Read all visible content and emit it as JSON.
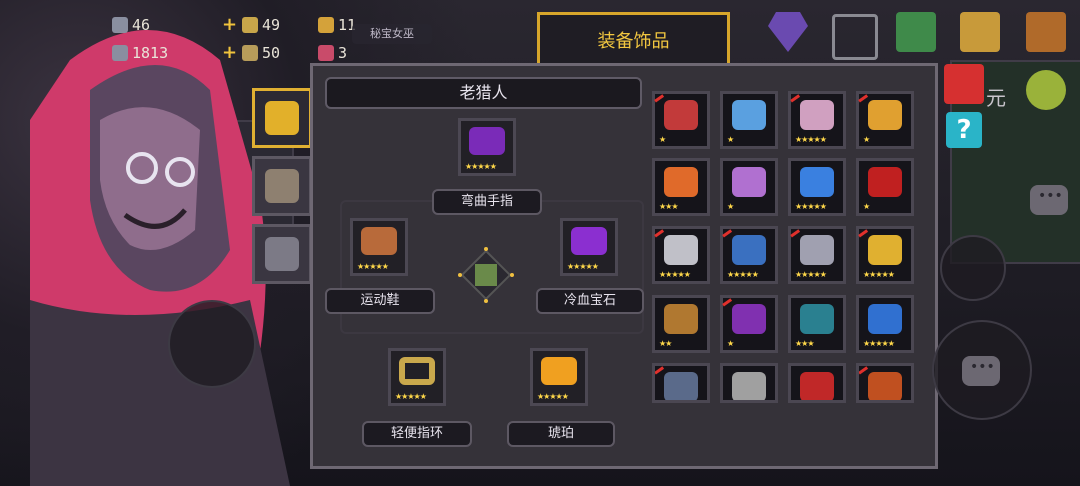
{
  "resources": [
    {
      "name": "gems",
      "value": "46",
      "color": "#8a8fa0"
    },
    {
      "name": "coins",
      "value": "49",
      "color": "#c8a64a"
    },
    {
      "name": "fish",
      "value": "11",
      "color": "#d4a23a"
    },
    {
      "name": "materials",
      "value": "1813",
      "color": "#8a8fa0"
    },
    {
      "name": "parts",
      "value": "50",
      "color": "#b79c5a"
    },
    {
      "name": "tickets",
      "value": "3",
      "color": "#c94b6a"
    }
  ],
  "witch_label": "秘宝女巫",
  "panel_title": "装备饰品",
  "character_name": "老猎人",
  "equipped": [
    {
      "label": "弯曲手指",
      "icon": "purple-ring-icon",
      "color": "#7a2bb8",
      "stars": "★★★★★"
    },
    {
      "label": "运动鞋",
      "icon": "sneaker-icon",
      "color": "#b86a3a",
      "stars": "★★★★★"
    },
    {
      "label": "冷血宝石",
      "icon": "purple-gem-icon",
      "color": "#8b2fd0",
      "stars": "★★★★★"
    },
    {
      "label": "轻便指环",
      "icon": "gold-ring-icon",
      "color": "#c9a84c",
      "stars": "★★★★★"
    },
    {
      "label": "琥珀",
      "icon": "amber-icon",
      "color": "#f0a020",
      "stars": "★★★★★"
    }
  ],
  "center_item": {
    "icon": "green-charm-icon",
    "color": "#6a8a4a"
  },
  "inventory": [
    {
      "icon": "red-bracelet-icon",
      "color": "#c23a3a",
      "stars": "★",
      "tag": true
    },
    {
      "icon": "blue-egg-icon",
      "color": "#5aa0e0",
      "stars": "★",
      "tag": false
    },
    {
      "icon": "necklace-icon",
      "color": "#d0a0c0",
      "stars": "★★★★★",
      "tag": true
    },
    {
      "icon": "gold-coin-icon",
      "color": "#e0a030",
      "stars": "★",
      "tag": true
    },
    {
      "icon": "target-icon",
      "color": "#e06a2a",
      "stars": "★★★",
      "tag": false
    },
    {
      "icon": "crystal-icon",
      "color": "#b070d0",
      "stars": "★",
      "tag": false
    },
    {
      "icon": "blue-gem-icon",
      "color": "#3a80e0",
      "stars": "★★★★★",
      "tag": false
    },
    {
      "icon": "red-crystal-icon",
      "color": "#c02020",
      "stars": "★",
      "tag": false
    },
    {
      "icon": "silver-feather-icon",
      "color": "#c0c0c8",
      "stars": "★★★★★",
      "tag": true
    },
    {
      "icon": "blue-boots-icon",
      "color": "#3a70c0",
      "stars": "★★★★★",
      "tag": true
    },
    {
      "icon": "chain-icon",
      "color": "#a0a0b0",
      "stars": "★★★★★",
      "tag": true
    },
    {
      "icon": "gold-helmet-icon",
      "color": "#e0b030",
      "stars": "★★★★★",
      "tag": true
    },
    {
      "icon": "cloak-icon",
      "color": "#b07830",
      "stars": "★★",
      "tag": false
    },
    {
      "icon": "purple-flame-icon",
      "color": "#8030b0",
      "stars": "★",
      "tag": true
    },
    {
      "icon": "teal-shell-icon",
      "color": "#2a8090",
      "stars": "★★★",
      "tag": false
    },
    {
      "icon": "blue-crystal-icon",
      "color": "#3070d0",
      "stars": "★★★★★",
      "tag": false
    },
    {
      "icon": "mesh-icon",
      "color": "#5a6a8a",
      "stars": "",
      "tag": true
    },
    {
      "icon": "fist-icon",
      "color": "#a0a0a0",
      "stars": "",
      "tag": false
    },
    {
      "icon": "red-cape-icon",
      "color": "#c02828",
      "stars": "",
      "tag": false
    },
    {
      "icon": "orange-cape-icon",
      "color": "#c05020",
      "stars": "",
      "tag": true
    }
  ],
  "right_label": "元"
}
